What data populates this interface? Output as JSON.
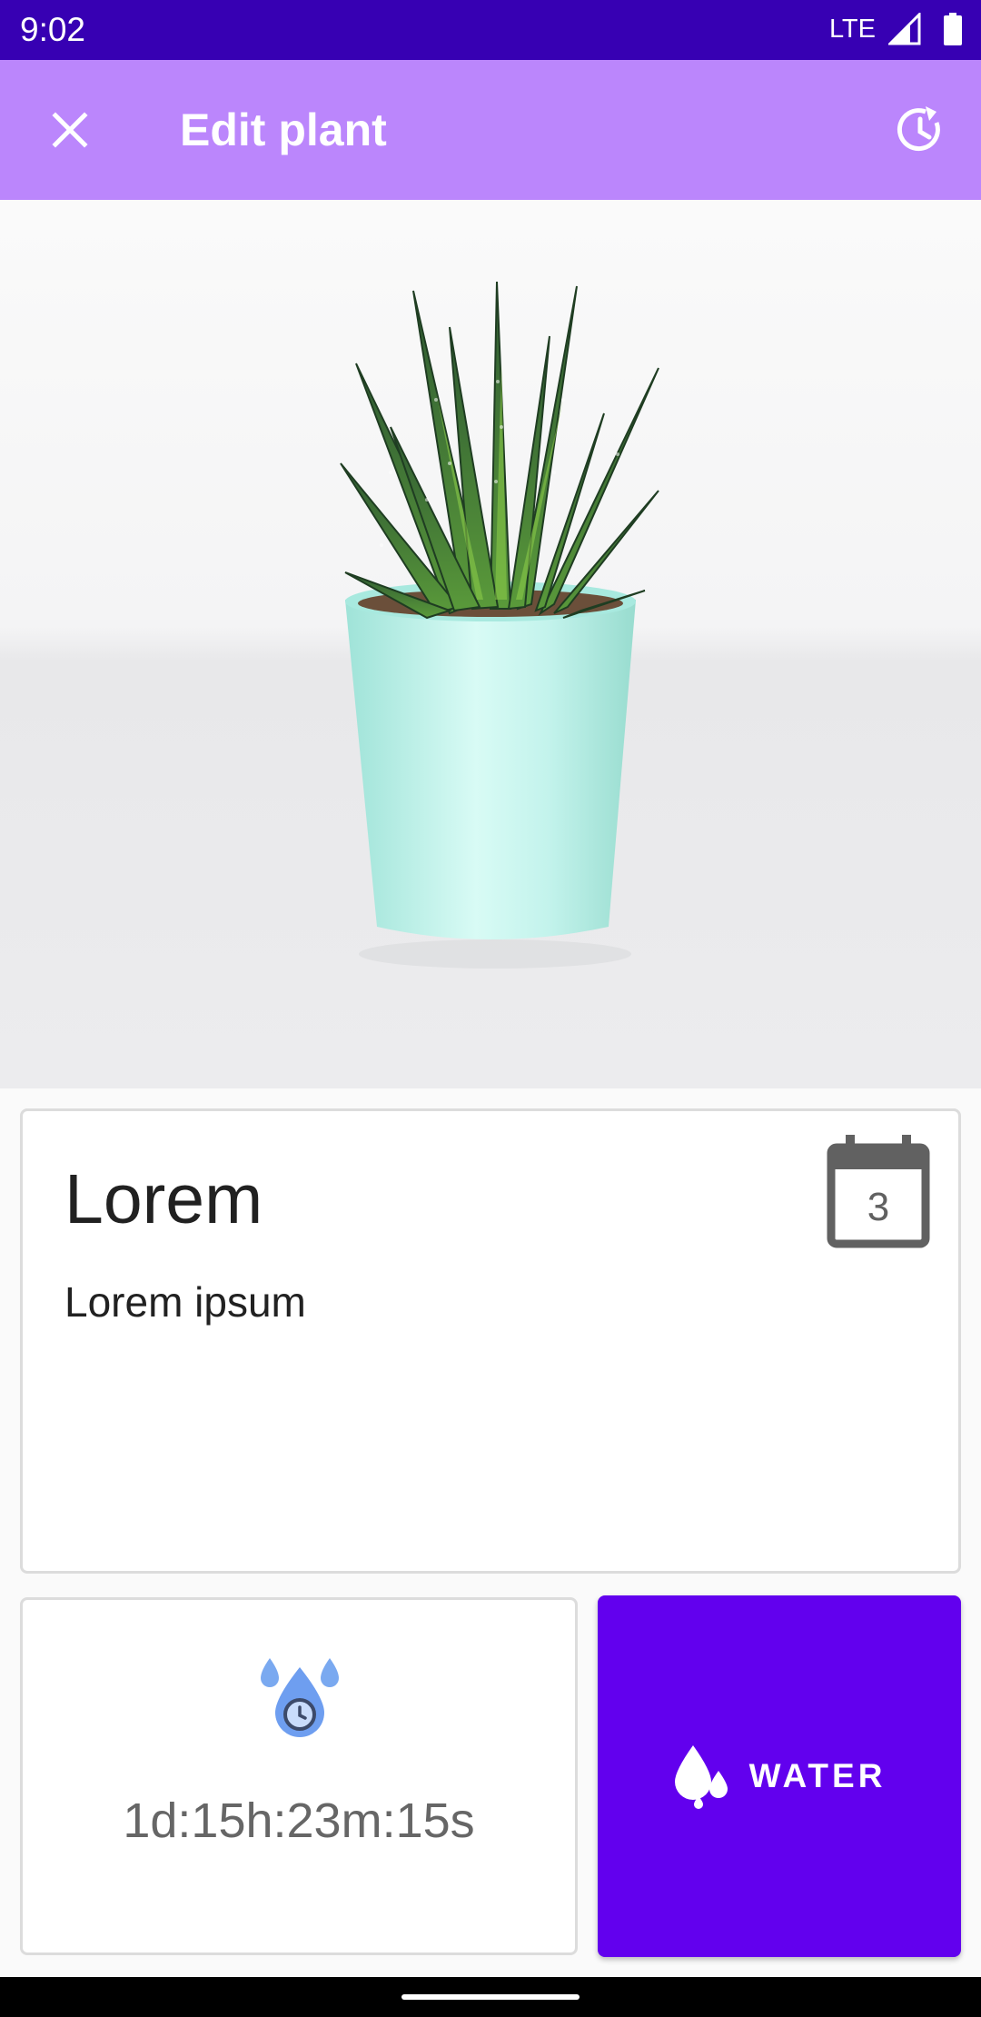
{
  "status_bar": {
    "time": "9:02",
    "network": "LTE"
  },
  "app_bar": {
    "title": "Edit plant",
    "close_icon": "close-icon",
    "reset_icon": "restore-clock-icon"
  },
  "photo": {
    "subject_icon": "succulent-plant-photo"
  },
  "plant": {
    "name": "Lorem",
    "description": "Lorem ipsum",
    "calendar_day": "3"
  },
  "timer": {
    "remaining": "1d:15h:23m:15s",
    "icon": "water-timer-icon"
  },
  "water_button": {
    "label": "WATER",
    "icon": "water-drops-icon"
  },
  "colors": {
    "status_bar": "#3700b3",
    "app_bar": "#bb86fc",
    "primary": "#6200ee",
    "pot": "#b7eee6"
  }
}
